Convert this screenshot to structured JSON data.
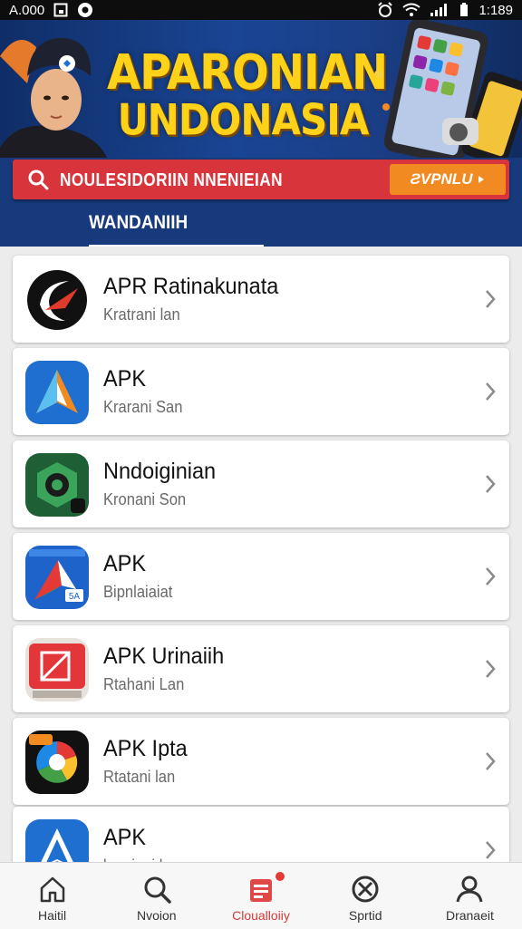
{
  "status_bar": {
    "left_text": "A.000",
    "right_text": "1:189"
  },
  "banner": {
    "title_line1": "APARONIAN",
    "title_line2": "UNDONASIA"
  },
  "search": {
    "text": "NOULESIDORIIN NNENIEIAN",
    "action_label": "ƧVPNLU"
  },
  "tab": {
    "label": "WANDANIIH"
  },
  "apps": [
    {
      "name": "APR Ratinakunata",
      "subtitle": "Kratrani lan",
      "icon": "crescent-logo-icon"
    },
    {
      "name": "APK",
      "subtitle": "Krarani San",
      "icon": "blue-arrow-app-icon"
    },
    {
      "name": "Nndoiginian",
      "subtitle": "Kronani Son",
      "icon": "green-hex-app-icon"
    },
    {
      "name": "APK",
      "subtitle": "Bipnlaiaiat",
      "icon": "blue-paper-plane-icon",
      "badge": "5A"
    },
    {
      "name": "APK Urinaiih",
      "subtitle": "Rtahani Lan",
      "icon": "red-square-app-icon"
    },
    {
      "name": "APK Ipta",
      "subtitle": "Rtatani lan",
      "icon": "colorful-circle-app-icon"
    },
    {
      "name": "APK",
      "subtitle": "lagniani lan",
      "icon": "blue-triangle-app-icon"
    }
  ],
  "nav": [
    {
      "label": "Haitil",
      "icon": "home-icon"
    },
    {
      "label": "Nvoion",
      "icon": "search-icon"
    },
    {
      "label": "Cloualloiiy",
      "icon": "clipboard-icon",
      "active": true
    },
    {
      "label": "Sprtid",
      "icon": "compass-icon"
    },
    {
      "label": "Dranaeit",
      "icon": "person-icon"
    }
  ],
  "colors": {
    "banner_bg": "#1a4594",
    "search_bar": "#d8343b",
    "search_action": "#f28a22",
    "accent_red": "#d93a3a"
  }
}
